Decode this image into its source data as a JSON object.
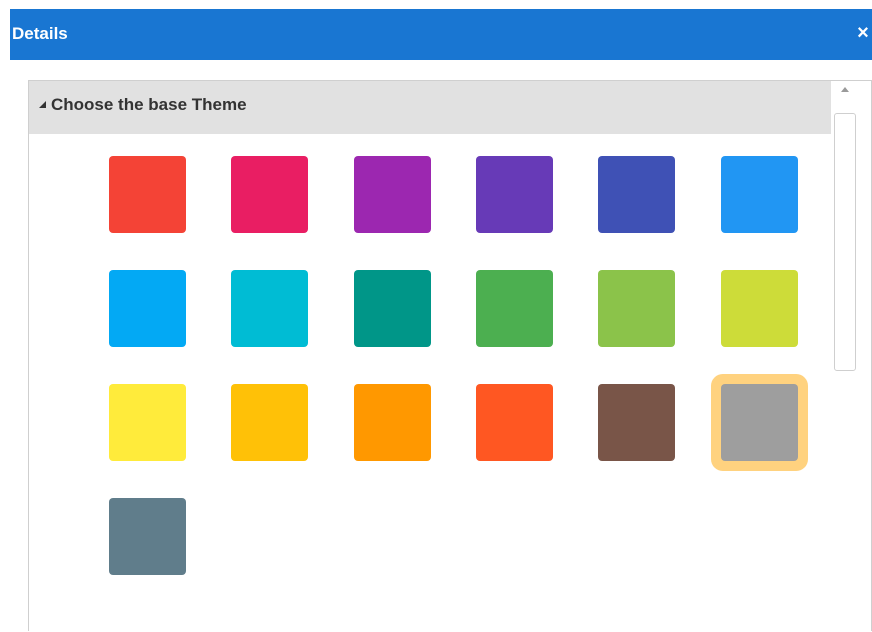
{
  "header": {
    "title": "Details",
    "close_icon": "×"
  },
  "section": {
    "title": "Choose the base Theme",
    "collapse_icon": "collapse-triangle-icon"
  },
  "theme_swatches": [
    {
      "color": "#f44336"
    },
    {
      "color": "#e91e63"
    },
    {
      "color": "#9c27b0"
    },
    {
      "color": "#673ab7"
    },
    {
      "color": "#3f51b5"
    },
    {
      "color": "#2196f3"
    },
    {
      "color": "#03a9f4"
    },
    {
      "color": "#00bcd4"
    },
    {
      "color": "#009688"
    },
    {
      "color": "#4caf50"
    },
    {
      "color": "#8bc34a"
    },
    {
      "color": "#cddc39"
    },
    {
      "color": "#ffeb3b"
    },
    {
      "color": "#ffc107"
    },
    {
      "color": "#ff9800"
    },
    {
      "color": "#ff5722"
    },
    {
      "color": "#795548"
    },
    {
      "color": "#9e9e9e",
      "selected": true
    },
    {
      "color": "#607d8b"
    }
  ],
  "colors": {
    "header_bg": "#1976d2",
    "section_header_bg": "#e1e1e1",
    "selection_outline": "#ffd27f"
  }
}
